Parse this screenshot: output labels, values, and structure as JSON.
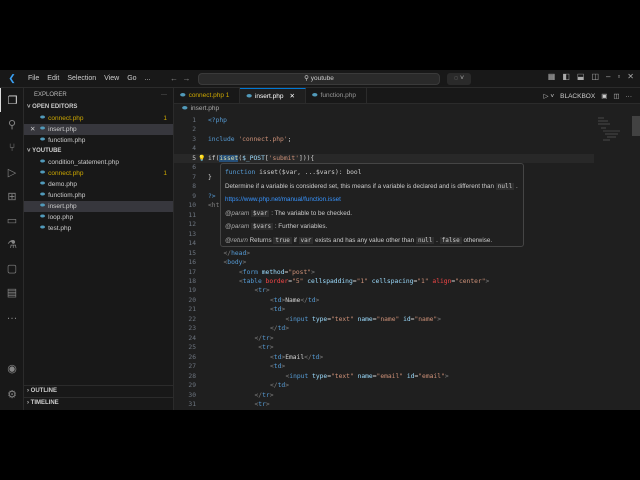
{
  "menu": [
    "File",
    "Edit",
    "Selection",
    "View",
    "Go",
    "..."
  ],
  "search": "youtube",
  "explorer": {
    "title": "EXPLORER",
    "open_editors_label": "OPEN EDITORS",
    "open_editors": [
      {
        "name": "connect.php",
        "badge": "1",
        "mod": true
      },
      {
        "name": "insert.php",
        "badge": "",
        "mod": false,
        "selected": true,
        "close": "✕"
      },
      {
        "name": "functiom.php",
        "badge": "",
        "mod": false
      }
    ],
    "folder_label": "YOUTUBE",
    "files": [
      {
        "name": "condition_statement.php",
        "badge": ""
      },
      {
        "name": "connect.php",
        "badge": "1",
        "mod": true
      },
      {
        "name": "demo.php",
        "badge": ""
      },
      {
        "name": "functiom.php",
        "badge": ""
      },
      {
        "name": "insert.php",
        "badge": "",
        "selected": true
      },
      {
        "name": "loop.php",
        "badge": ""
      },
      {
        "name": "test.php",
        "badge": ""
      }
    ],
    "outline": "OUTLINE",
    "timeline": "TIMELINE"
  },
  "tabs": [
    {
      "name": "connect.php 1",
      "mod": true
    },
    {
      "name": "insert.php",
      "active": true,
      "close": "✕"
    },
    {
      "name": "function.php"
    }
  ],
  "editor_tools": {
    "blackbox": "BLACKBOX"
  },
  "breadcrumb": "insert.php",
  "code": [
    {
      "n": "1",
      "i": 0,
      "t": [
        [
          "<?php",
          "kw"
        ]
      ]
    },
    {
      "n": "2",
      "i": 0,
      "t": []
    },
    {
      "n": "3",
      "i": 0,
      "t": [
        [
          "include ",
          "kw"
        ],
        [
          "'connect.php'",
          "str"
        ],
        [
          ";",
          "pl"
        ]
      ]
    },
    {
      "n": "4",
      "i": 0,
      "t": []
    },
    {
      "n": "5",
      "i": 0,
      "cur": true,
      "t": [
        [
          "if(",
          "pl"
        ],
        [
          "isset",
          "fn"
        ],
        [
          "(",
          "pl"
        ],
        [
          "$_POST",
          "var"
        ],
        [
          "[",
          "pl"
        ],
        [
          "'submit'",
          "str"
        ],
        [
          "])){",
          "pl"
        ]
      ]
    },
    {
      "n": "6",
      "i": 0,
      "t": []
    },
    {
      "n": "7",
      "i": 0,
      "t": [
        [
          "}",
          "pl"
        ]
      ]
    },
    {
      "n": "8",
      "i": 0,
      "t": []
    },
    {
      "n": "9",
      "i": 0,
      "t": [
        [
          "?>",
          "kw"
        ]
      ]
    },
    {
      "n": "10",
      "i": 0,
      "t": [
        [
          "<ht",
          "tag"
        ]
      ]
    },
    {
      "n": "11",
      "i": 0,
      "t": []
    },
    {
      "n": "12",
      "i": 0,
      "t": []
    },
    {
      "n": "13",
      "i": 0,
      "t": []
    },
    {
      "n": "14",
      "i": 0,
      "t": []
    },
    {
      "n": "15",
      "i": 1,
      "t": [
        [
          "</",
          "tag"
        ],
        [
          "head",
          "tn"
        ],
        [
          ">",
          "tag"
        ]
      ]
    },
    {
      "n": "16",
      "i": 1,
      "t": [
        [
          "<",
          "tag"
        ],
        [
          "body",
          "tn"
        ],
        [
          ">",
          "tag"
        ]
      ]
    },
    {
      "n": "17",
      "i": 2,
      "t": [
        [
          "<",
          "tag"
        ],
        [
          "form ",
          "tn"
        ],
        [
          "method",
          "at"
        ],
        [
          "=",
          "pl"
        ],
        [
          "\"post\"",
          "str"
        ],
        [
          ">",
          "tag"
        ]
      ]
    },
    {
      "n": "18",
      "i": 2,
      "t": [
        [
          "<",
          "tag"
        ],
        [
          "table ",
          "tn"
        ],
        [
          "border",
          "at2"
        ],
        [
          "=",
          "pl"
        ],
        [
          "\"5\" ",
          "str"
        ],
        [
          "cellspadding",
          "at"
        ],
        [
          "=",
          "pl"
        ],
        [
          "\"1\" ",
          "str"
        ],
        [
          "cellspacing",
          "at"
        ],
        [
          "=",
          "pl"
        ],
        [
          "\"1\" ",
          "str"
        ],
        [
          "align",
          "at2"
        ],
        [
          "=",
          "pl"
        ],
        [
          "\"center\"",
          "str"
        ],
        [
          ">",
          "tag"
        ]
      ]
    },
    {
      "n": "19",
      "i": 3,
      "t": [
        [
          "<",
          "tag"
        ],
        [
          "tr",
          "tn"
        ],
        [
          ">",
          "tag"
        ]
      ]
    },
    {
      "n": "20",
      "i": 4,
      "t": [
        [
          "<",
          "tag"
        ],
        [
          "td",
          "tn"
        ],
        [
          ">",
          "tag"
        ],
        [
          "Name",
          "pl"
        ],
        [
          "</",
          "tag"
        ],
        [
          "td",
          "tn"
        ],
        [
          ">",
          "tag"
        ]
      ]
    },
    {
      "n": "21",
      "i": 4,
      "t": [
        [
          "<",
          "tag"
        ],
        [
          "td",
          "tn"
        ],
        [
          ">",
          "tag"
        ]
      ]
    },
    {
      "n": "22",
      "i": 5,
      "t": [
        [
          "<",
          "tag"
        ],
        [
          "input ",
          "tn"
        ],
        [
          "type",
          "at"
        ],
        [
          "=",
          "pl"
        ],
        [
          "\"text\" ",
          "str"
        ],
        [
          "name",
          "at"
        ],
        [
          "=",
          "pl"
        ],
        [
          "\"name\" ",
          "str"
        ],
        [
          "id",
          "at"
        ],
        [
          "=",
          "pl"
        ],
        [
          "\"name\"",
          "str"
        ],
        [
          ">",
          "tag"
        ]
      ]
    },
    {
      "n": "23",
      "i": 4,
      "t": [
        [
          "</",
          "tag"
        ],
        [
          "td",
          "tn"
        ],
        [
          ">",
          "tag"
        ]
      ]
    },
    {
      "n": "24",
      "i": 3,
      "t": [
        [
          "</",
          "tag"
        ],
        [
          "tr",
          "tn"
        ],
        [
          ">",
          "tag"
        ]
      ]
    },
    {
      "n": "25",
      "i": 3,
      "t": [
        [
          " <",
          "tag"
        ],
        [
          "tr",
          "tn"
        ],
        [
          ">",
          "tag"
        ]
      ]
    },
    {
      "n": "26",
      "i": 4,
      "t": [
        [
          "<",
          "tag"
        ],
        [
          "td",
          "tn"
        ],
        [
          ">",
          "tag"
        ],
        [
          "Email",
          "pl"
        ],
        [
          "</",
          "tag"
        ],
        [
          "td",
          "tn"
        ],
        [
          ">",
          "tag"
        ]
      ]
    },
    {
      "n": "27",
      "i": 4,
      "t": [
        [
          "<",
          "tag"
        ],
        [
          "td",
          "tn"
        ],
        [
          ">",
          "tag"
        ]
      ]
    },
    {
      "n": "28",
      "i": 5,
      "t": [
        [
          "<",
          "tag"
        ],
        [
          "input ",
          "tn"
        ],
        [
          "type",
          "at"
        ],
        [
          "=",
          "pl"
        ],
        [
          "\"text\" ",
          "str"
        ],
        [
          "name",
          "at"
        ],
        [
          "=",
          "pl"
        ],
        [
          "\"email\" ",
          "str"
        ],
        [
          "id",
          "at"
        ],
        [
          "=",
          "pl"
        ],
        [
          "\"email\"",
          "str"
        ],
        [
          ">",
          "tag"
        ]
      ]
    },
    {
      "n": "29",
      "i": 4,
      "t": [
        [
          "</",
          "tag"
        ],
        [
          "td",
          "tn"
        ],
        [
          ">",
          "tag"
        ]
      ]
    },
    {
      "n": "30",
      "i": 3,
      "t": [
        [
          "</",
          "tag"
        ],
        [
          "tr",
          "tn"
        ],
        [
          ">",
          "tag"
        ]
      ]
    },
    {
      "n": "31",
      "i": 3,
      "t": [
        [
          "<",
          "tag"
        ],
        [
          "tr",
          "tn"
        ],
        [
          ">",
          "tag"
        ]
      ]
    }
  ],
  "hover": {
    "sig_kw": "function",
    "sig_name": "isset",
    "sig_rest": "($var, ...$vars): bool",
    "desc": "Determine if a variable is considered set, this means if a variable is declared and is different than",
    "desc_code": "null",
    "desc_end": ".",
    "link": "https://www.php.net/manual/function.isset",
    "p1_tag": "@param",
    "p1_var": "$var",
    "p1_text": ": The variable to be checked.",
    "p2_tag": "@param",
    "p2_var": "$vars",
    "p2_text": ": Further variables.",
    "r_tag": "@return",
    "r_a": "Returns",
    "r_c1": "true",
    "r_b": "if",
    "r_c2": "var",
    "r_c": "exists and has any value other than",
    "r_c3": "null",
    "r_d": ".",
    "r_c4": "false",
    "r_e": "otherwise."
  }
}
